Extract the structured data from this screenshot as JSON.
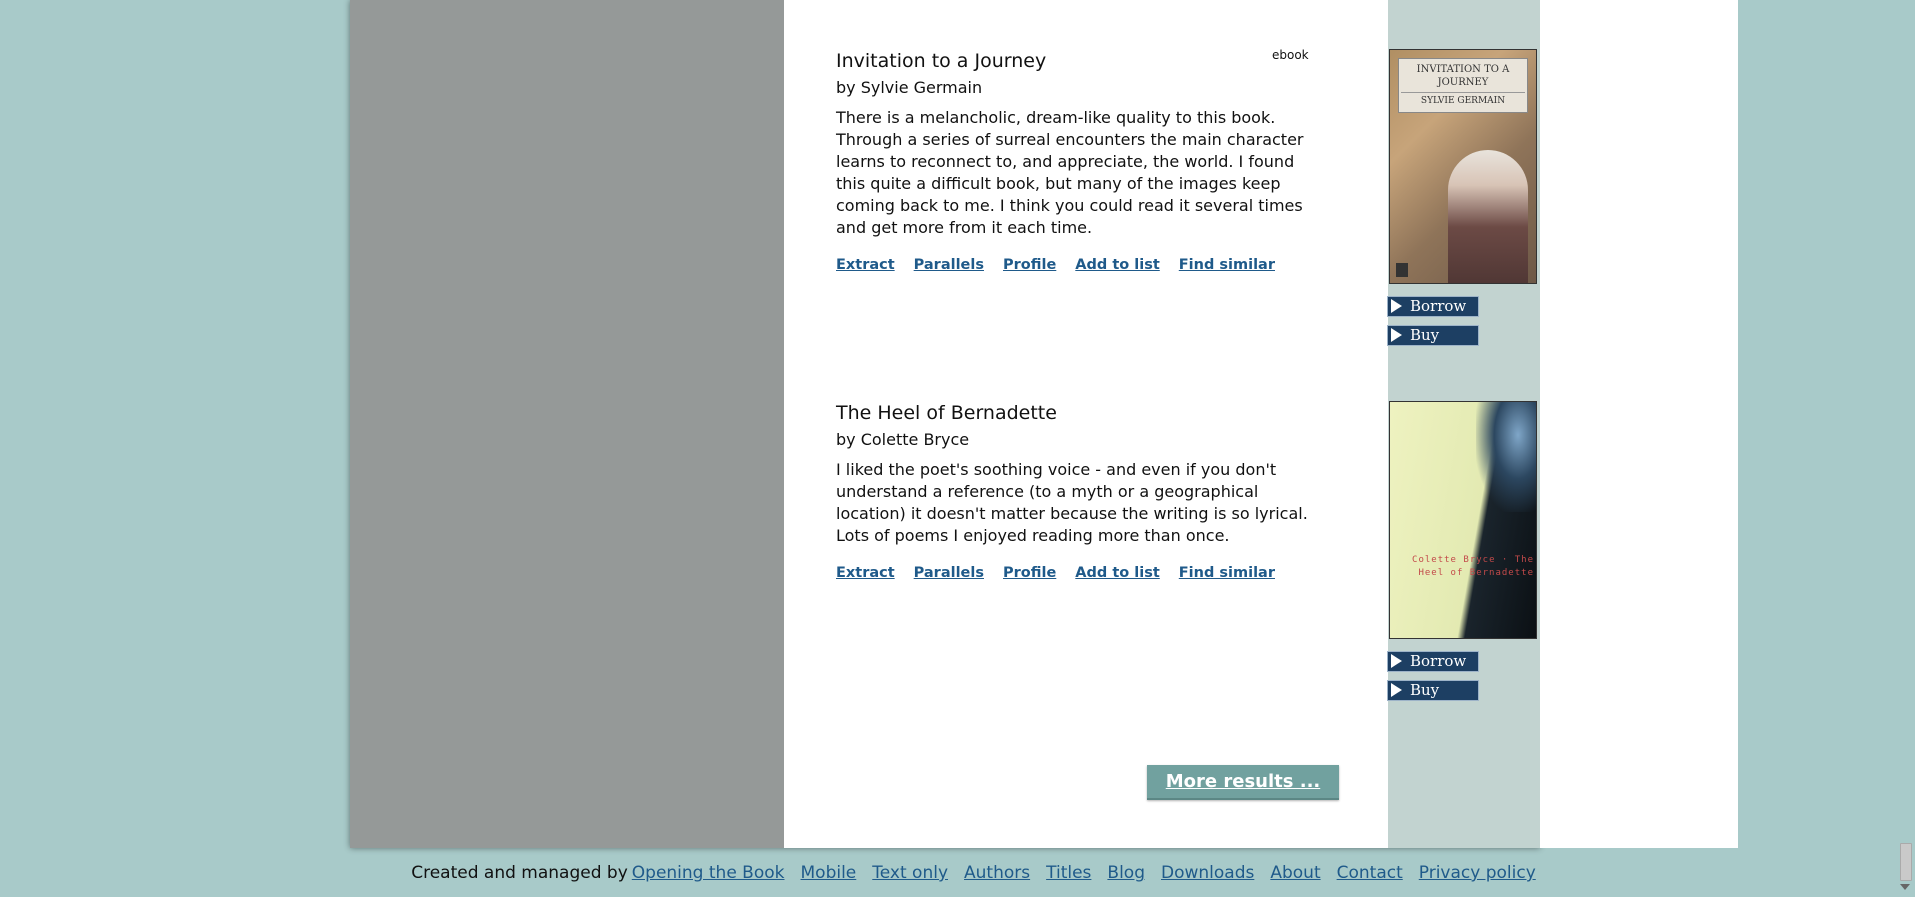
{
  "books": [
    {
      "title": "Invitation to a Journey",
      "author": "by Sylvie Germain",
      "format": "ebook",
      "description": "There is a melancholic, dream-like quality to this book. Through a series of surreal encounters the main character learns to reconnect to, and appreciate, the world. I found this quite a difficult book, but many of the images keep coming back to me. I think you could read it several times and get more from it each time.",
      "links": [
        "Extract",
        "Parallels",
        "Profile",
        "Add to list",
        "Find similar"
      ],
      "cover_title": "INVITATION TO A JOURNEY",
      "cover_author": "SYLVIE GERMAIN",
      "borrow_label": "Borrow",
      "buy_label": "Buy"
    },
    {
      "title": "The Heel of Bernadette",
      "author": "by Colette Bryce",
      "description": "I liked the poet's soothing voice - and even if you don't understand a reference (to a myth or a geographical location) it doesn't matter because the writing is so lyrical. Lots of poems I enjoyed reading more than once.",
      "links": [
        "Extract",
        "Parallels",
        "Profile",
        "Add to list",
        "Find similar"
      ],
      "cover_text": "Colette Bryce · The Heel of Bernadette",
      "borrow_label": "Borrow",
      "buy_label": "Buy"
    }
  ],
  "more_results_label": "More results ...",
  "footer": {
    "created_text": "Created and managed by",
    "links": [
      "Opening the Book",
      "Mobile",
      "Text only",
      "Authors",
      "Titles",
      "Blog",
      "Downloads",
      "About",
      "Contact",
      "Privacy policy"
    ]
  },
  "colors": {
    "background": "#a8cac9",
    "link": "#1f5a8a",
    "button_dark": "#1d3f63",
    "more_button": "#71a19f"
  }
}
